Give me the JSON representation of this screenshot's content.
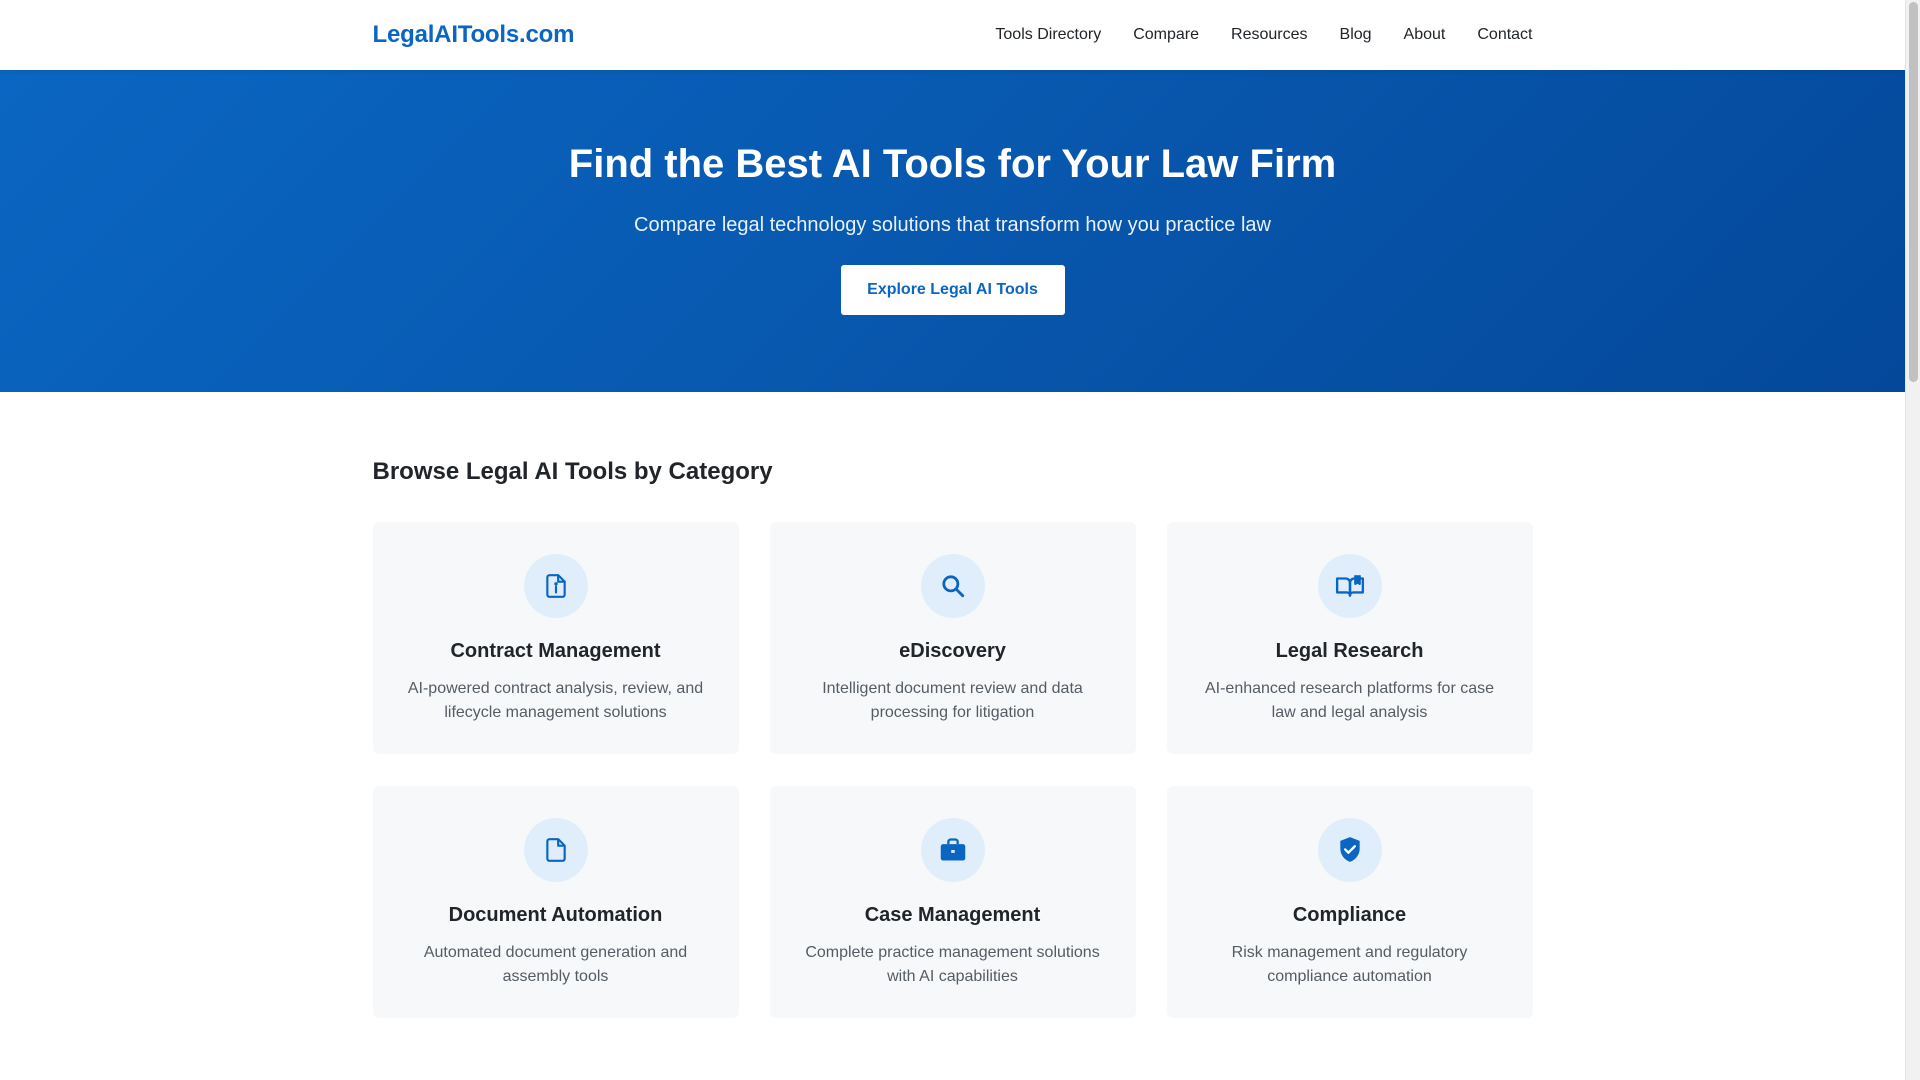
{
  "header": {
    "logo": "LegalAITools.com",
    "nav": [
      {
        "label": "Tools Directory"
      },
      {
        "label": "Compare"
      },
      {
        "label": "Resources"
      },
      {
        "label": "Blog"
      },
      {
        "label": "About"
      },
      {
        "label": "Contact"
      }
    ]
  },
  "hero": {
    "title": "Find the Best AI Tools for Your Law Firm",
    "subtitle": "Compare legal technology solutions that transform how you practice law",
    "cta_label": "Explore Legal AI Tools"
  },
  "categories": {
    "title": "Browse Legal AI Tools by Category",
    "items": [
      {
        "icon": "contract-document-icon",
        "title": "Contract Management",
        "description": "AI-powered contract analysis, review, and lifecycle management solutions"
      },
      {
        "icon": "search-icon",
        "title": "eDiscovery",
        "description": "Intelligent document review and data processing for litigation"
      },
      {
        "icon": "open-book-icon",
        "title": "Legal Research",
        "description": "AI-enhanced research platforms for case law and legal analysis"
      },
      {
        "icon": "document-icon",
        "title": "Document Automation",
        "description": "Automated document generation and assembly tools"
      },
      {
        "icon": "briefcase-icon",
        "title": "Case Management",
        "description": "Complete practice management solutions with AI capabilities"
      },
      {
        "icon": "shield-check-icon",
        "title": "Compliance",
        "description": "Risk management and regulatory compliance automation"
      }
    ]
  },
  "colors": {
    "brand": "#0a66c2",
    "hero_gradient_start": "#0a66c2",
    "hero_gradient_end": "#04489a",
    "card_bg": "#f6f8fa",
    "icon_bg": "#e0eefb"
  }
}
